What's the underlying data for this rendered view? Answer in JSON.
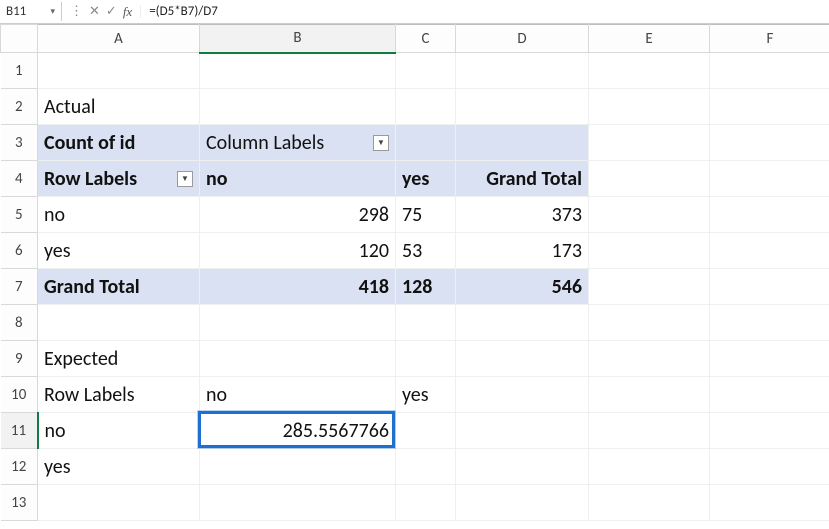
{
  "formula_bar": {
    "cell_ref": "B11",
    "formula": "=(D5*B7)/D7"
  },
  "col_headers": [
    "A",
    "B",
    "C",
    "D",
    "E",
    "F"
  ],
  "row_headers": [
    "1",
    "2",
    "3",
    "4",
    "5",
    "6",
    "7",
    "8",
    "9",
    "10",
    "11",
    "12",
    "13"
  ],
  "active": {
    "col": "B",
    "row": "11"
  },
  "cells": {
    "A2": "Actual",
    "A3": "Count of id",
    "B3": "Column Labels",
    "A4": "Row Labels",
    "B4": "no",
    "C4": "yes",
    "D4": "Grand Total",
    "A5": "no",
    "B5": "298",
    "C5": "75",
    "D5": "373",
    "A6": "yes",
    "B6": "120",
    "C6": "53",
    "D6": "173",
    "A7": "Grand Total",
    "B7": "418",
    "C7": "128",
    "D7": "546",
    "A9": "Expected",
    "A10": "Row Labels",
    "B10": "no",
    "C10": "yes",
    "A11": "no",
    "B11": "285.5567766",
    "A12": "yes"
  },
  "icons": {
    "dropdown": "▾",
    "cancel": "✕",
    "confirm": "✓",
    "fx": "fx",
    "divider": "⋮",
    "filter": "▼"
  }
}
